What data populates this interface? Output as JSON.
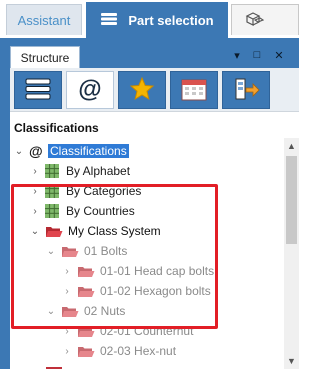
{
  "tabs": {
    "assistant": "Assistant",
    "part_selection": "Part selection"
  },
  "panel": {
    "title": "Structure",
    "pin_glyph": "▾",
    "maximize_glyph": "□",
    "close_glyph": "✕"
  },
  "toolbar": {
    "at_glyph": "@"
  },
  "section": {
    "title": "Classifications"
  },
  "tree": {
    "root": {
      "label": "Classifications",
      "prefix": "@"
    },
    "items": [
      {
        "label": "By Alphabet"
      },
      {
        "label": "By Categories"
      },
      {
        "label": "By Countries"
      },
      {
        "label": "My Class System"
      },
      {
        "label": "01 Bolts"
      },
      {
        "label": "01-01 Head cap bolts"
      },
      {
        "label": "01-02 Hexagon bolts"
      },
      {
        "label": "02 Nuts"
      },
      {
        "label": "02-01 Counternut"
      },
      {
        "label": "02-03 Hex-nut"
      }
    ]
  },
  "colors": {
    "accent": "#3c78b4",
    "highlight": "#2f7bd6",
    "annotation_red": "#e21e26",
    "folder_red": "#d9343e",
    "folder_red_dim": "#e08a90",
    "star": "#f5b400"
  }
}
